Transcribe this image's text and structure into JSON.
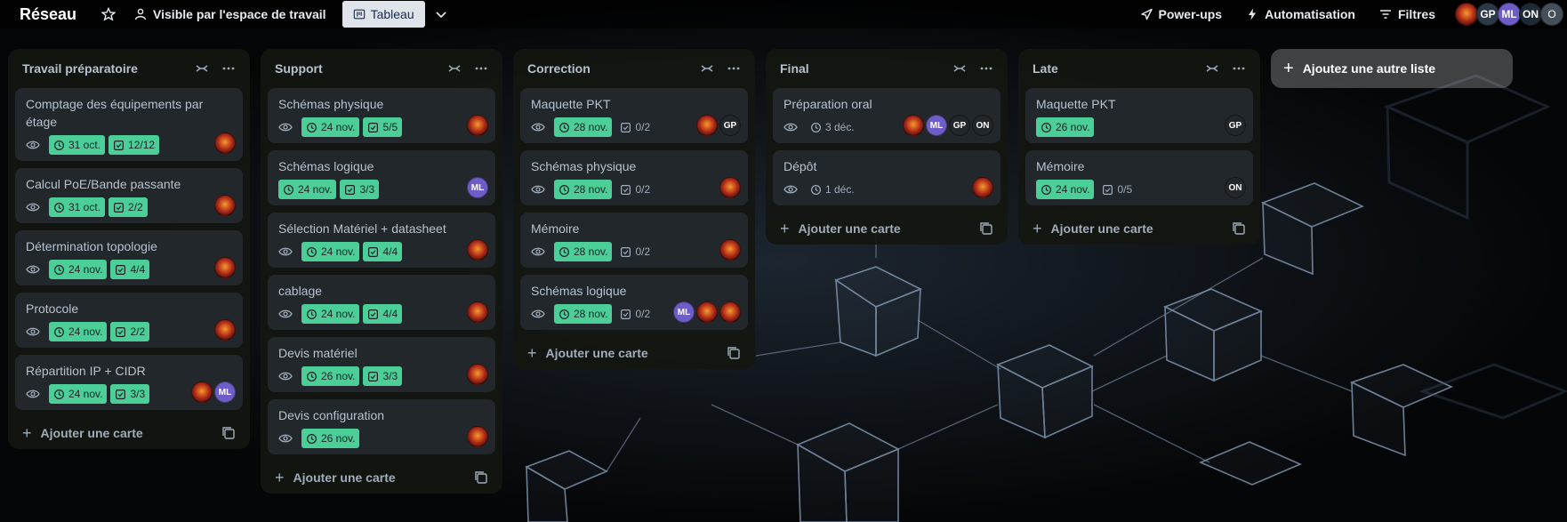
{
  "colors": {
    "date_badge": "#4bce97",
    "card_bg": "#22272b",
    "list_bg": "#14160f",
    "avatar_ml": "#6e5dc6",
    "avatar_dark": "#22272b"
  },
  "topbar": {
    "board_title": "Réseau",
    "star_icon": "star-icon",
    "visibility_label": "Visible par l'espace de travail",
    "view_label": "Tableau",
    "powerups_label": "Power-ups",
    "automation_label": "Automatisation",
    "filters_label": "Filtres",
    "members": [
      "GP",
      "ML",
      "ON",
      "O"
    ]
  },
  "add_list_label": "Ajoutez une autre liste",
  "add_card_label": "Ajouter une carte",
  "lists": [
    {
      "title": "Travail préparatoire",
      "cards": [
        {
          "title": "Comptage des équipements par étage",
          "date": "31 oct.",
          "check": "12/12"
        },
        {
          "title": "Calcul PoE/Bande passante",
          "date": "31 oct.",
          "check": "2/2"
        },
        {
          "title": "Détermination topologie",
          "date": "24 nov.",
          "check": "4/4"
        },
        {
          "title": "Protocole",
          "date": "24 nov.",
          "check": "2/2"
        },
        {
          "title": "Répartition IP + CIDR",
          "date": "24 nov.",
          "check": "3/3",
          "members": [
            "ML"
          ]
        }
      ]
    },
    {
      "title": "Support",
      "cards": [
        {
          "title": "Schémas physique",
          "date": "24 nov.",
          "check": "5/5"
        },
        {
          "title": "Schémas logique",
          "date": "24 nov.",
          "check": "3/3",
          "members": [
            "ML"
          ]
        },
        {
          "title": "Sélection Matériel + datasheet",
          "date": "24 nov.",
          "check": "4/4"
        },
        {
          "title": "cablage",
          "date": "24 nov.",
          "check": "4/4"
        },
        {
          "title": "Devis matériel",
          "date": "26 nov.",
          "check": "3/3"
        },
        {
          "title": "Devis configuration",
          "date": "26 nov."
        }
      ]
    },
    {
      "title": "Correction",
      "cards": [
        {
          "title": "Maquette PKT",
          "date": "28 nov.",
          "check": "0/2",
          "members": [
            "GP"
          ]
        },
        {
          "title": "Schémas physique",
          "date": "28 nov.",
          "check": "0/2"
        },
        {
          "title": "Mémoire",
          "date": "28 nov.",
          "check": "0/2"
        },
        {
          "title": "Schémas logique",
          "date": "28 nov.",
          "check": "0/2",
          "members": [
            "ML"
          ]
        }
      ]
    },
    {
      "title": "Final",
      "cards": [
        {
          "title": "Préparation oral",
          "date": "3 déc.",
          "members": [
            "ML",
            "GP",
            "ON"
          ]
        },
        {
          "title": "Dépôt",
          "date": "1 déc."
        }
      ]
    },
    {
      "title": "Late",
      "cards": [
        {
          "title": "Maquette PKT",
          "date": "26 nov.",
          "members": [
            "GP"
          ]
        },
        {
          "title": "Mémoire",
          "date": "24 nov.",
          "check": "0/5",
          "members": [
            "ON"
          ]
        }
      ]
    }
  ]
}
